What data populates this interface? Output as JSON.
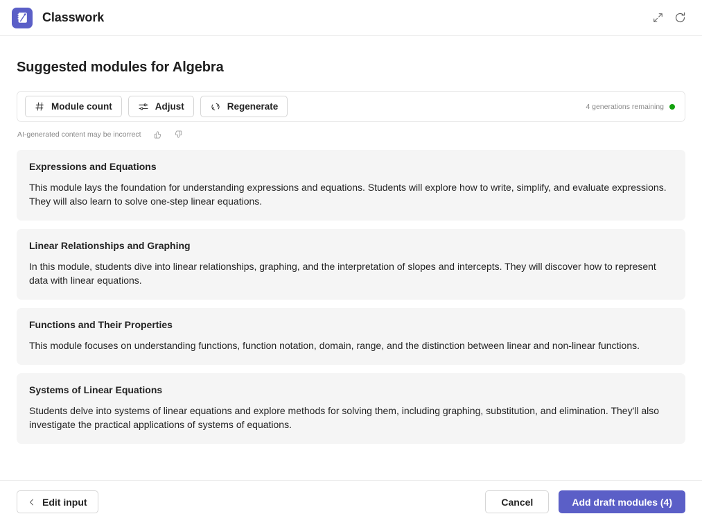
{
  "header": {
    "app_icon_name": "classwork-app-icon",
    "title": "Classwork",
    "expand_icon": "expand-icon",
    "refresh_icon": "refresh-icon"
  },
  "main": {
    "page_title": "Suggested modules for Algebra",
    "toolbar": {
      "buttons": [
        {
          "label": "Module count",
          "icon": "number-sign-icon"
        },
        {
          "label": "Adjust",
          "icon": "sliders-icon"
        },
        {
          "label": "Regenerate",
          "icon": "arrow-sync-icon"
        }
      ],
      "generations_remaining": "4 generations remaining",
      "status_color": "#13a10e"
    },
    "ai_note": {
      "text": "AI-generated content may be incorrect",
      "thumbs_up_icon": "thumb-like-icon",
      "thumbs_down_icon": "thumb-dislike-icon"
    },
    "cards": [
      {
        "title": "Expressions and Equations",
        "description": "This module lays the foundation for understanding expressions and equations. Students will explore how to write, simplify, and evaluate expressions. They will also learn to solve one-step linear equations."
      },
      {
        "title": "Linear Relationships and Graphing",
        "description": "In this module, students dive into linear relationships, graphing, and the interpretation of slopes and intercepts. They will discover how to represent data with linear equations."
      },
      {
        "title": "Functions and Their Properties",
        "description": "This module focuses on understanding functions, function notation, domain, range, and the distinction between linear and non-linear functions."
      },
      {
        "title": "Systems of Linear Equations",
        "description": "Students delve into systems of linear equations and explore methods for solving them, including graphing, substitution, and elimination. They'll also investigate the practical applications of systems of equations."
      }
    ]
  },
  "footer": {
    "edit_input_label": "Edit input",
    "back_icon": "chevron-left-icon",
    "cancel_label": "Cancel",
    "primary_label": "Add draft modules (4)",
    "primary_color": "#5b5fc7"
  }
}
